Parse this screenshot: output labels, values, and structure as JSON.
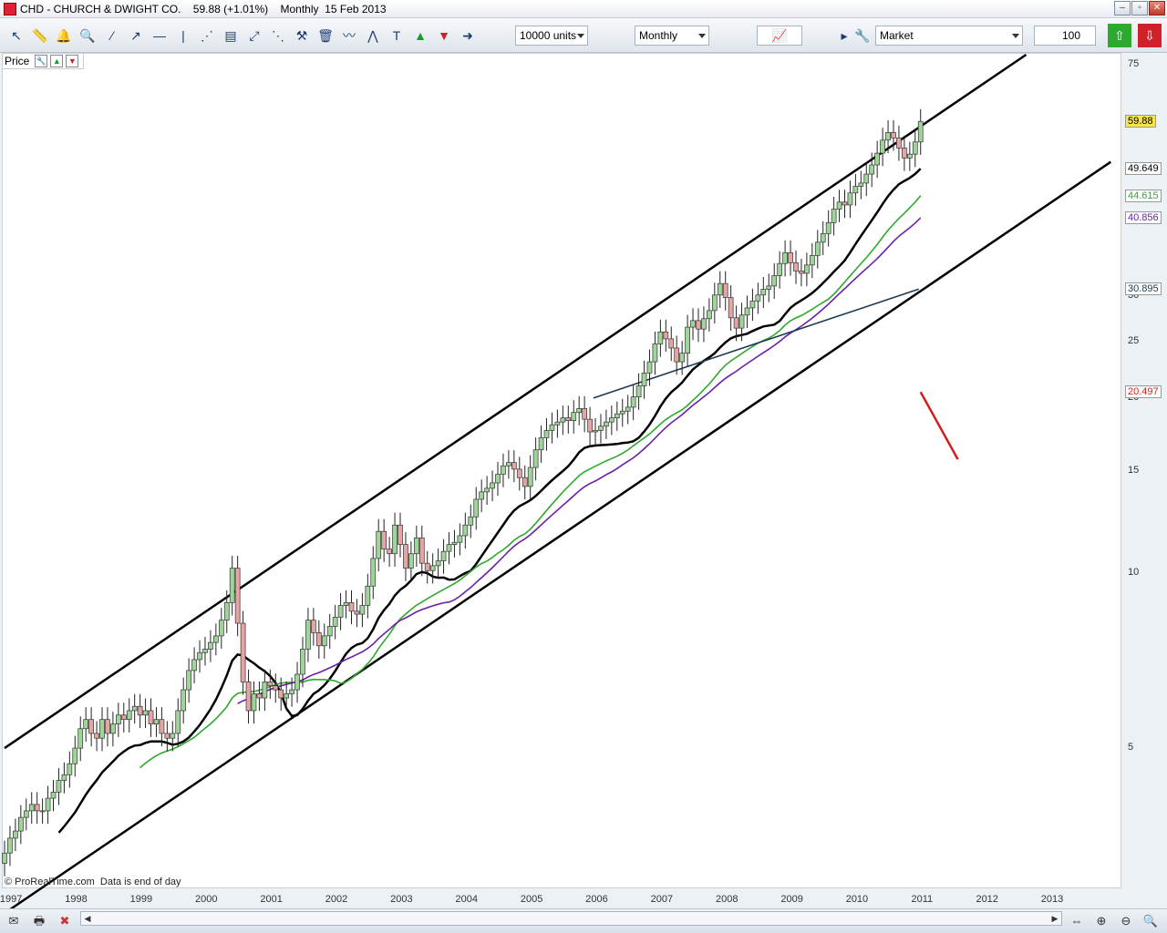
{
  "window": {
    "title": "CHD - CHURCH & DWIGHT CO.    59.88 (+1.01%)    Monthly  15 Feb 2013"
  },
  "toolbar": {
    "units_select": "10000 units",
    "period_select": "Monthly",
    "order_select": "Market",
    "quantity_value": "100",
    "icons": [
      "cursor-icon",
      "ruler-icon",
      "alarm-icon",
      "zoom-icon",
      "line-icon",
      "ray-icon",
      "hline-icon",
      "vline-icon",
      "fork-icon",
      "channel-icon",
      "fib-icon",
      "fan-icon",
      "tools-icon",
      "trash-icon",
      "wave-icon",
      "zigzag-icon",
      "text-icon",
      "buy-arrow-icon",
      "sell-arrow-icon",
      "next-arrow-icon"
    ]
  },
  "panel": {
    "label": "Price"
  },
  "credit": "© ProRealTime.com  Data is end of day",
  "price_tags": [
    {
      "text": "59.88",
      "color": "#000000",
      "bg": "#f7e34a"
    },
    {
      "text": "49.649",
      "color": "#000000",
      "bg": "#ffffff"
    },
    {
      "text": "44.615",
      "color": "#2ea82e",
      "bg": "#ffffff"
    },
    {
      "text": "40.856",
      "color": "#6a1fa8",
      "bg": "#ffffff"
    },
    {
      "text": "30.895",
      "color": "#1b3a55",
      "bg": "#ffffff"
    },
    {
      "text": "20.497",
      "color": "#d41e1e",
      "bg": "#ffffff"
    }
  ],
  "chart_data": {
    "type": "candlestick",
    "scale": "log",
    "ylim": [
      2.9,
      78
    ],
    "y_ticks": [
      5,
      10,
      15,
      20,
      25,
      30,
      75
    ],
    "x_ticks": [
      "1997",
      "1998",
      "1999",
      "2000",
      "2001",
      "2002",
      "2003",
      "2004",
      "2005",
      "2006",
      "2007",
      "2008",
      "2009",
      "2010",
      "2011",
      "2012",
      "2013"
    ],
    "close_series": {
      "x_start": 1996.9,
      "x_step": 0.0833,
      "values": [
        3.3,
        3.5,
        3.6,
        3.8,
        3.9,
        4.0,
        3.9,
        3.9,
        4.1,
        4.2,
        4.4,
        4.5,
        4.7,
        5.0,
        5.4,
        5.6,
        5.3,
        5.2,
        5.6,
        5.3,
        5.5,
        5.7,
        5.6,
        5.8,
        5.9,
        5.7,
        5.8,
        5.5,
        5.6,
        5.3,
        5.2,
        5.3,
        5.8,
        6.3,
        6.8,
        7.1,
        7.3,
        7.4,
        7.6,
        7.8,
        8.3,
        8.9,
        10.2,
        8.2,
        6.5,
        5.8,
        6.2,
        6.1,
        6.5,
        6.4,
        6.3,
        6.1,
        6.2,
        6.3,
        6.7,
        7.4,
        8.3,
        7.9,
        7.5,
        7.8,
        8.1,
        8.4,
        8.8,
        8.9,
        8.6,
        8.5,
        8.8,
        9.5,
        10.6,
        11.8,
        11.0,
        10.8,
        12.1,
        11.2,
        10.2,
        10.8,
        11.5,
        10.4,
        10.1,
        10.3,
        10.5,
        10.9,
        11.2,
        11.3,
        11.6,
        12.1,
        12.5,
        13.4,
        13.8,
        14.0,
        14.3,
        14.8,
        15.3,
        15.5,
        15.1,
        14.6,
        14.1,
        15.2,
        16.3,
        17.1,
        17.6,
        18.0,
        18.2,
        18.5,
        18.3,
        18.9,
        19.2,
        18.4,
        17.5,
        17.6,
        17.9,
        18.2,
        18.5,
        18.8,
        19.0,
        19.3,
        20.1,
        21.0,
        22.1,
        23.1,
        24.8,
        26.0,
        25.3,
        24.4,
        23.1,
        23.9,
        26.5,
        27.2,
        26.3,
        27.4,
        28.3,
        30.1,
        31.5,
        29.8,
        27.5,
        26.4,
        27.8,
        28.6,
        29.4,
        30.1,
        30.8,
        31.2,
        32.5,
        34.1,
        35.6,
        34.2,
        33.1,
        32.8,
        33.9,
        35.2,
        37.1,
        38.4,
        40.1,
        42.3,
        43.5,
        43.0,
        45.1,
        46.3,
        46.9,
        48.6,
        50.4,
        52.8,
        55.6,
        57.3,
        56.1,
        53.9,
        51.8,
        52.6,
        55.2,
        59.88
      ]
    },
    "lines": [
      {
        "name": "",
        "color": "#000000",
        "points": [
          [
            1996.9,
            5.0
          ],
          [
            2012.6,
            78
          ]
        ]
      },
      {
        "name": "",
        "color": "#000000",
        "points": [
          [
            1996.9,
            2.6
          ],
          [
            2013.9,
            51
          ]
        ]
      },
      {
        "name": "",
        "color": "#000000",
        "values_from": 1997.7,
        "last": 49.649
      },
      {
        "name": "",
        "color": "#2ea82e",
        "values_from": 1998.9,
        "last": 44.615
      },
      {
        "name": "",
        "color": "#6a1fa8",
        "values_from": 2000.4,
        "last": 40.856
      },
      {
        "name": "",
        "color": "#1b3a55",
        "values_from": 2005.95,
        "last": 30.895
      },
      {
        "name": "",
        "color": "#d41e1e",
        "values_from": 2011.55,
        "last": 20.497
      }
    ]
  },
  "footer": {
    "icons": [
      "mail-icon",
      "print-icon",
      "delete-icon",
      "zoom-fit-icon",
      "zoom-in-icon",
      "zoom-out-icon",
      "magnify-icon"
    ]
  }
}
